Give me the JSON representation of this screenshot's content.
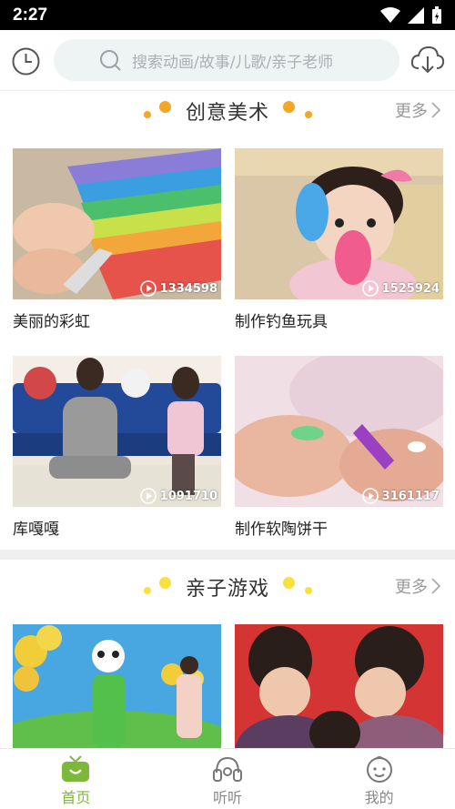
{
  "status_bar": {
    "time": "2:27"
  },
  "header": {
    "search_placeholder": "搜索动画/故事/儿歌/亲子老师",
    "history_icon": "clock-icon",
    "download_icon": "cloud-download-icon"
  },
  "sections": [
    {
      "title": "创意美术",
      "more": "更多",
      "items": [
        {
          "title": "美丽的彩虹",
          "plays": "1334598"
        },
        {
          "title": "制作钓鱼玩具",
          "plays": "1525924"
        },
        {
          "title": "库嘎嘎",
          "plays": "1091710"
        },
        {
          "title": "制作软陶饼干",
          "plays": "3161117"
        }
      ]
    },
    {
      "title": "亲子游戏",
      "more": "更多",
      "items": [
        {
          "title": "",
          "plays": ""
        },
        {
          "title": "",
          "plays": ""
        }
      ]
    }
  ],
  "tabs": [
    {
      "label": "首页",
      "icon": "tv-icon",
      "active": true
    },
    {
      "label": "听听",
      "icon": "headphones-icon",
      "active": false
    },
    {
      "label": "我的",
      "icon": "child-face-icon",
      "active": false
    }
  ],
  "colors": {
    "accent": "#7cb83a",
    "dot": "#f5a623",
    "search_bg": "#eef3f3"
  }
}
